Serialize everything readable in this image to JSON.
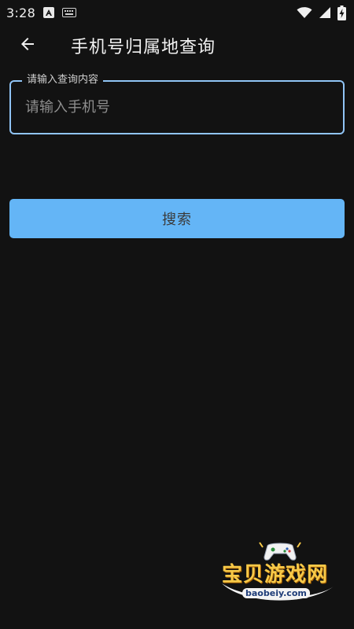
{
  "status_bar": {
    "time": "3:28",
    "icons": [
      "notification-a-icon",
      "keyboard-icon",
      "wifi-icon",
      "signal-icon",
      "battery-charging-icon"
    ]
  },
  "toolbar": {
    "back_icon": "arrow-left-icon",
    "title": "手机号归属地查询"
  },
  "query_field": {
    "label": "请输入查询内容",
    "placeholder": "请输入手机号",
    "value": ""
  },
  "search_button": {
    "label": "搜索"
  },
  "watermark": {
    "brand": "宝贝游戏网",
    "url": "baobeiy.com"
  },
  "colors": {
    "background": "#121212",
    "accent": "#64b5f6",
    "field_border": "#90c4f5"
  }
}
